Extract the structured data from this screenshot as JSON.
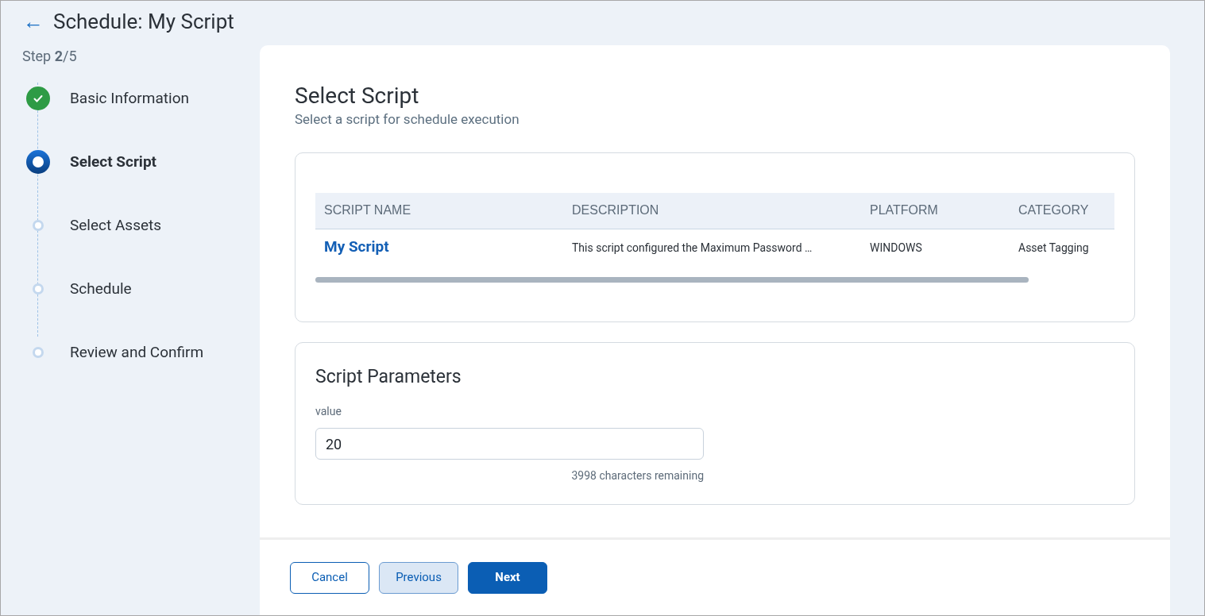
{
  "header": {
    "back_icon": "←",
    "title": "Schedule: My Script"
  },
  "step_indicator": "Step **2**/5",
  "steps": [
    {
      "label": "Basic Information",
      "kind": "done"
    },
    {
      "label": "Select Script",
      "kind": "current"
    },
    {
      "label": "Select Assets",
      "kind": "pending"
    },
    {
      "label": "Schedule",
      "kind": "pending"
    },
    {
      "label": "Review and Confirm",
      "kind": "pending"
    }
  ],
  "section": {
    "title": "Select Script",
    "subtitle": "Select a script for schedule execution"
  },
  "table": {
    "columns": [
      "SCRIPT NAME",
      "DESCRIPTION",
      "PLATFORM",
      "CATEGORY"
    ],
    "rows": [
      {
        "cells": [
          "My Script",
          "This script configured the Maximum Password …",
          "WINDOWS",
          "Asset Tagging"
        ]
      }
    ]
  },
  "parameters": {
    "title": "Script Parameters",
    "field_label": "value",
    "value": "20",
    "helper": "3998 characters remaining"
  },
  "buttons": [
    {
      "label": "Cancel",
      "kind": "outline"
    },
    {
      "label": "Previous",
      "kind": "soft"
    },
    {
      "label": "Next",
      "kind": "primary"
    }
  ]
}
